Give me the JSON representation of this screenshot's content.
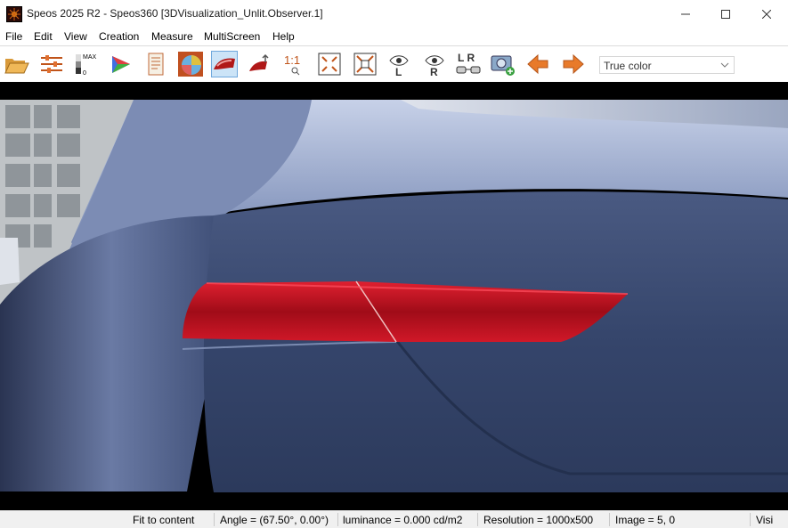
{
  "window": {
    "title": "Speos 2025 R2 - Speos360 [3DVisualization_Unlit.Observer.1]"
  },
  "menu": [
    "File",
    "Edit",
    "View",
    "Creation",
    "Measure",
    "MultiScreen",
    "Help"
  ],
  "toolbar": {
    "display_mode": "True color",
    "zoom_label": "1:1",
    "left_eye_label": "L",
    "right_eye_label": "R",
    "stereo_label": "L R",
    "levels_max_label": "MAX",
    "levels_min_label": "0"
  },
  "status": {
    "fit": "Fit to content",
    "angle": "Angle = (67.50°, 0.00°)",
    "luminance": "luminance = 0.000 cd/m2",
    "resolution": "Resolution = 1000x500",
    "image": "Image = 5, 0",
    "visi": "Visi"
  },
  "colors": {
    "car_paint": "#3a4a6e",
    "tail_light": "#b0101a",
    "background": "#ffffff",
    "statusbar": "#f0f0f0"
  },
  "icons": [
    "open-folder-icon",
    "sliders-icon",
    "levels-icon",
    "color-gamut-icon",
    "document-icon",
    "color-sphere-icon",
    "car-view-icon",
    "car-light-icon",
    "zoom-1to1-icon",
    "fit-icon",
    "fit-selection-icon",
    "eye-left-icon",
    "eye-right-icon",
    "stereo-glasses-icon",
    "screenshot-icon",
    "arrow-left-icon",
    "arrow-right-icon"
  ]
}
